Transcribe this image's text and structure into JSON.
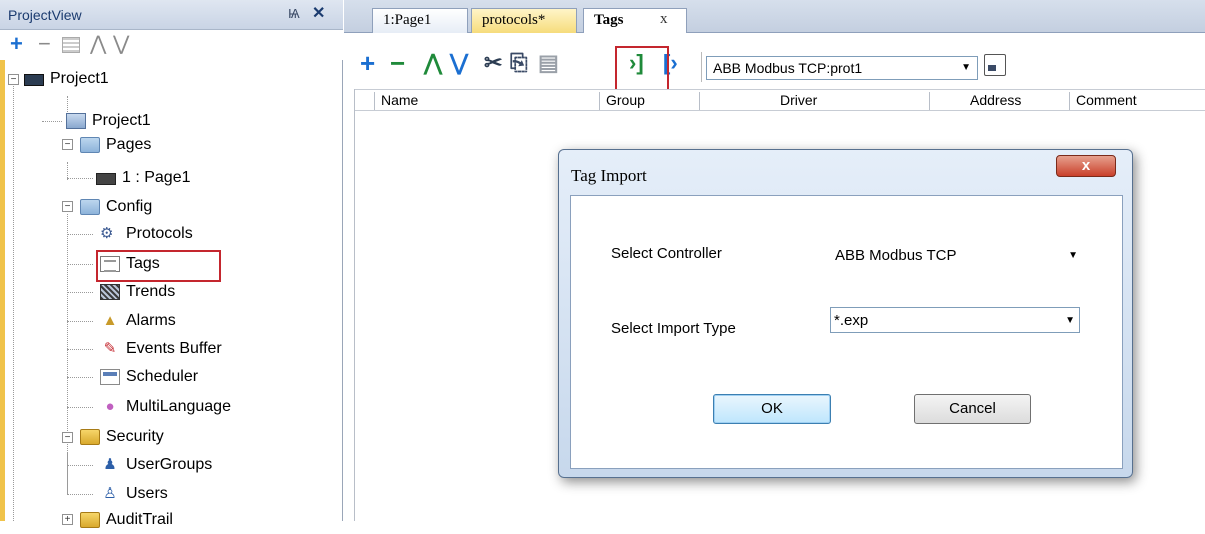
{
  "project_view": {
    "title": "ProjectView",
    "pin_glyph": "Ѩ",
    "close_glyph": "✕",
    "toolbar": {
      "add_glyph": "+",
      "remove_glyph": "−",
      "up_glyph": "⋀",
      "down_glyph": "⋁"
    },
    "tree": {
      "project_root": "Project1",
      "project_item": "Project1",
      "pages": "Pages",
      "page1": "1 : Page1",
      "config": "Config",
      "protocols": "Protocols",
      "tags": "Tags",
      "trends": "Trends",
      "alarms": "Alarms",
      "events_buffer": "Events Buffer",
      "scheduler": "Scheduler",
      "multilanguage": "MultiLanguage",
      "security": "Security",
      "usergroups": "UserGroups",
      "users": "Users",
      "audittrail": "AuditTrail"
    }
  },
  "tabs": {
    "page1": "1:Page1",
    "protocols": "protocols*",
    "tags": "Tags",
    "close_glyph": "x"
  },
  "tags_toolbar": {
    "add_glyph": "+",
    "remove_glyph": "−",
    "up_glyph": "⋀",
    "down_glyph": "⋁",
    "cut_glyph": "✂",
    "copy_glyph": "⎘",
    "paste_glyph": "▤",
    "import_glyph": "›]",
    "export_glyph": "[›",
    "protocol_value": "ABB Modbus TCP:prot1",
    "dropdown_glyph": "▼"
  },
  "grid": {
    "columns": [
      "Name",
      "Group",
      "Driver",
      "Address",
      "Comment"
    ]
  },
  "dialog": {
    "title": "Tag Import",
    "close_glyph": "x",
    "controller_label": "Select Controller",
    "controller_value": "ABB Modbus TCP",
    "import_type_label": "Select Import Type",
    "import_type_value": "*.exp",
    "dropdown_glyph": "▼",
    "ok_label": "OK",
    "cancel_label": "Cancel"
  },
  "colors": {
    "highlight": "#c4262e",
    "accent_blue": "#1b6fd1",
    "panel_header": "#c9d4e5"
  }
}
